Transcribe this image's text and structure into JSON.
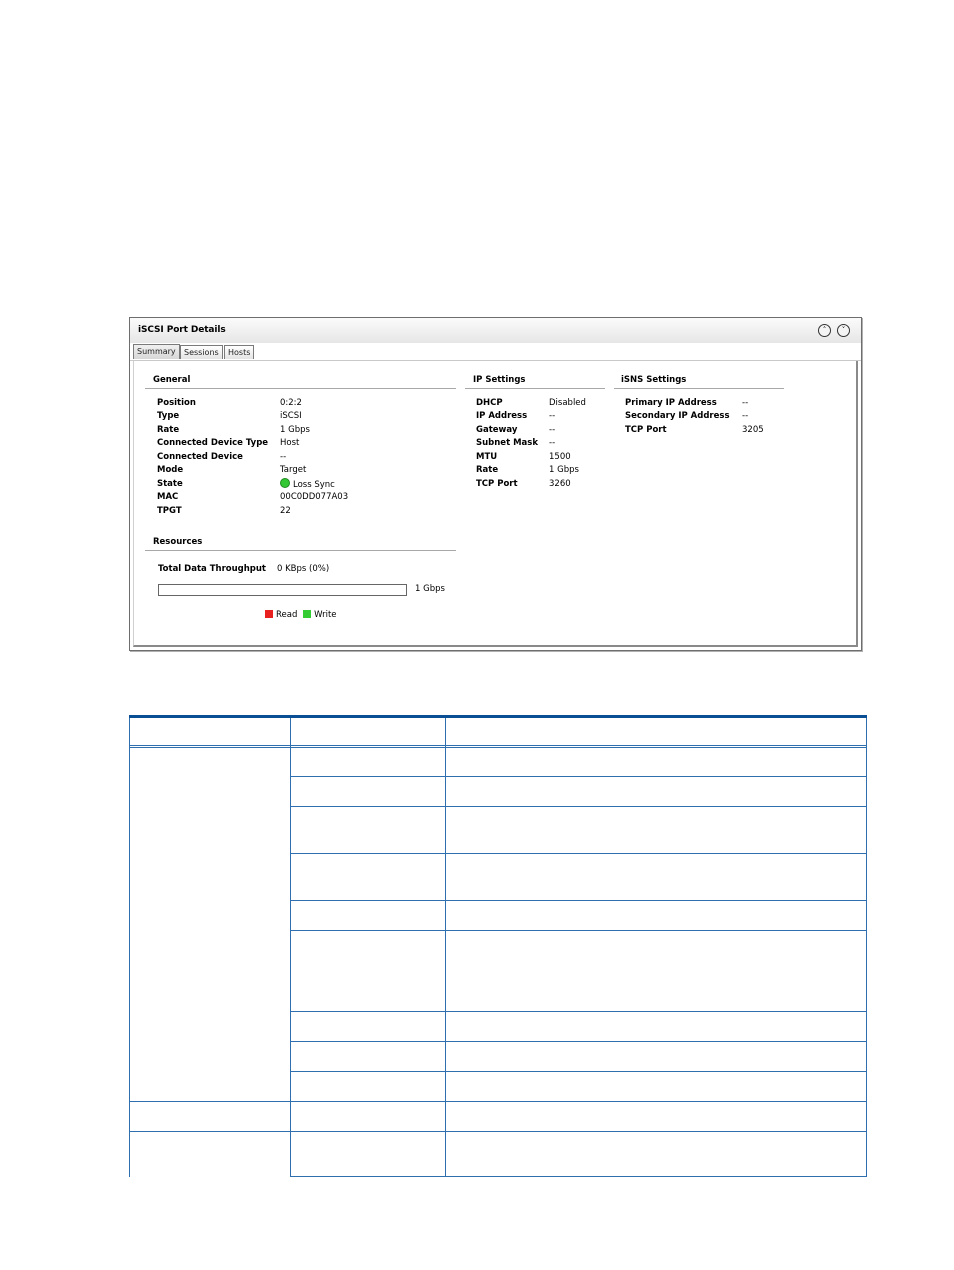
{
  "panel": {
    "title": "iSCSI Port Details",
    "collapse_icon": "chevron-up-circle-icon",
    "expand_icon": "chevron-down-circle-icon",
    "tabs": [
      {
        "label": "Summary",
        "active": true
      },
      {
        "label": "Sessions",
        "active": false
      },
      {
        "label": "Hosts",
        "active": false
      }
    ]
  },
  "general": {
    "title": "General",
    "rows": [
      {
        "label": "Position",
        "value": "0:2:2"
      },
      {
        "label": "Type",
        "value": "iSCSI"
      },
      {
        "label": "Rate",
        "value": "1 Gbps"
      },
      {
        "label": "Connected Device Type",
        "value": "Host"
      },
      {
        "label": "Connected Device",
        "value": "--"
      },
      {
        "label": "Mode",
        "value": "Target"
      },
      {
        "label": "State",
        "value": "Loss Sync",
        "status_color": "#34c734"
      },
      {
        "label": "MAC",
        "value": "00C0DD077A03"
      },
      {
        "label": "TPGT",
        "value": "22"
      }
    ]
  },
  "ip_settings": {
    "title": "IP Settings",
    "rows": [
      {
        "label": "DHCP",
        "value": "Disabled"
      },
      {
        "label": "IP Address",
        "value": "--"
      },
      {
        "label": "Gateway",
        "value": "--"
      },
      {
        "label": "Subnet Mask",
        "value": "--"
      },
      {
        "label": "MTU",
        "value": "1500"
      },
      {
        "label": "Rate",
        "value": "1 Gbps"
      },
      {
        "label": "TCP Port",
        "value": "3260"
      }
    ]
  },
  "isns_settings": {
    "title": "iSNS Settings",
    "rows": [
      {
        "label": "Primary IP Address",
        "value": "--"
      },
      {
        "label": "Secondary IP Address",
        "value": "--"
      },
      {
        "label": "TCP Port",
        "value": "3205"
      }
    ]
  },
  "resources": {
    "title": "Resources",
    "throughput_label": "Total Data Throughput",
    "throughput_value": "0 KBps (0%)",
    "bar_fill_fraction": 0,
    "bar_max_label": "1 Gbps",
    "legend": [
      {
        "label": "Read",
        "color": "#e82020"
      },
      {
        "label": "Write",
        "color": "#33cc33"
      }
    ]
  },
  "table": {
    "header_color": "#0a4f94",
    "rule_color": "#2f6fb0"
  }
}
